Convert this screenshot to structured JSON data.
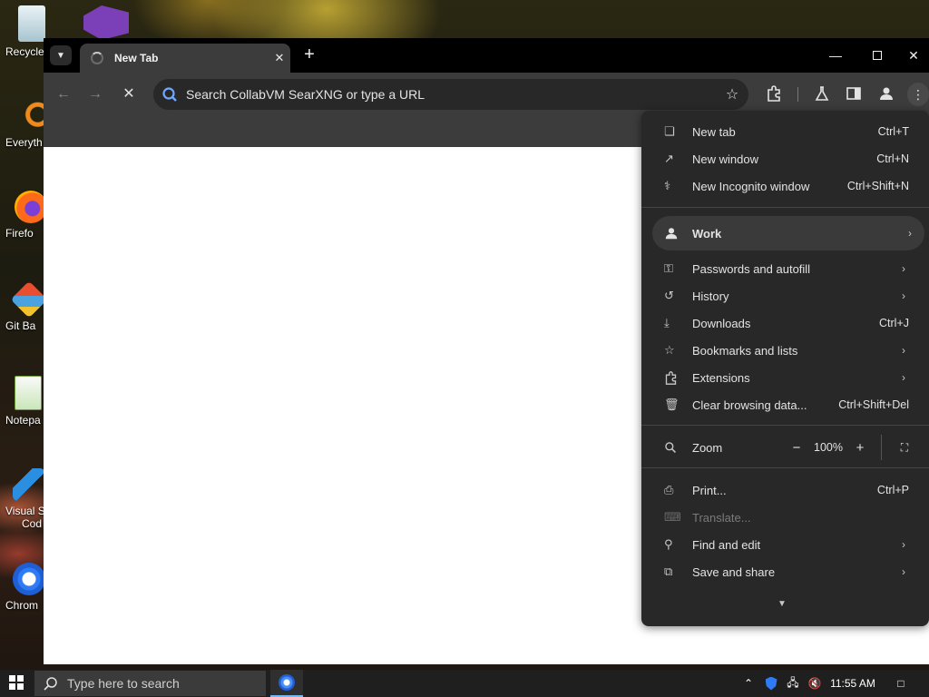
{
  "desktop": {
    "icons": [
      {
        "label": "Recycle",
        "icon": "recycle-bin-icon"
      },
      {
        "label": "Everyth",
        "icon": "everything-search-icon"
      },
      {
        "label": "Firefo",
        "icon": "firefox-icon"
      },
      {
        "label": "Git Ba",
        "icon": "git-bash-icon"
      },
      {
        "label": "Notepa",
        "icon": "notepad-plus-plus-icon"
      },
      {
        "label": "Visual St",
        "label2": "Cod",
        "icon": "vscode-icon"
      },
      {
        "label": "Chrom",
        "icon": "chrome-icon"
      }
    ]
  },
  "browser": {
    "tab": {
      "title": "New Tab"
    },
    "omnibox": {
      "placeholder": "Search CollabVM SearXNG or type a URL"
    }
  },
  "menu": {
    "items": [
      {
        "label": "New tab",
        "shortcut": "Ctrl+T"
      },
      {
        "label": "New window",
        "shortcut": "Ctrl+N"
      },
      {
        "label": "New Incognito window",
        "shortcut": "Ctrl+Shift+N"
      },
      {
        "label": "Work"
      },
      {
        "label": "Passwords and autofill"
      },
      {
        "label": "History"
      },
      {
        "label": "Downloads",
        "shortcut": "Ctrl+J"
      },
      {
        "label": "Bookmarks and lists"
      },
      {
        "label": "Extensions"
      },
      {
        "label": "Clear browsing data...",
        "shortcut": "Ctrl+Shift+Del"
      },
      {
        "label": "Zoom",
        "value": "100%"
      },
      {
        "label": "Print...",
        "shortcut": "Ctrl+P"
      },
      {
        "label": "Translate..."
      },
      {
        "label": "Find and edit"
      },
      {
        "label": "Save and share"
      }
    ]
  },
  "taskbar": {
    "search_placeholder": "Type here to search",
    "time": "11:55 AM"
  },
  "colors": {
    "titlebar": "#000000",
    "toolbar": "#3c3c3c",
    "menu_bg": "#282828",
    "accent_search": "#6ea8ff"
  }
}
